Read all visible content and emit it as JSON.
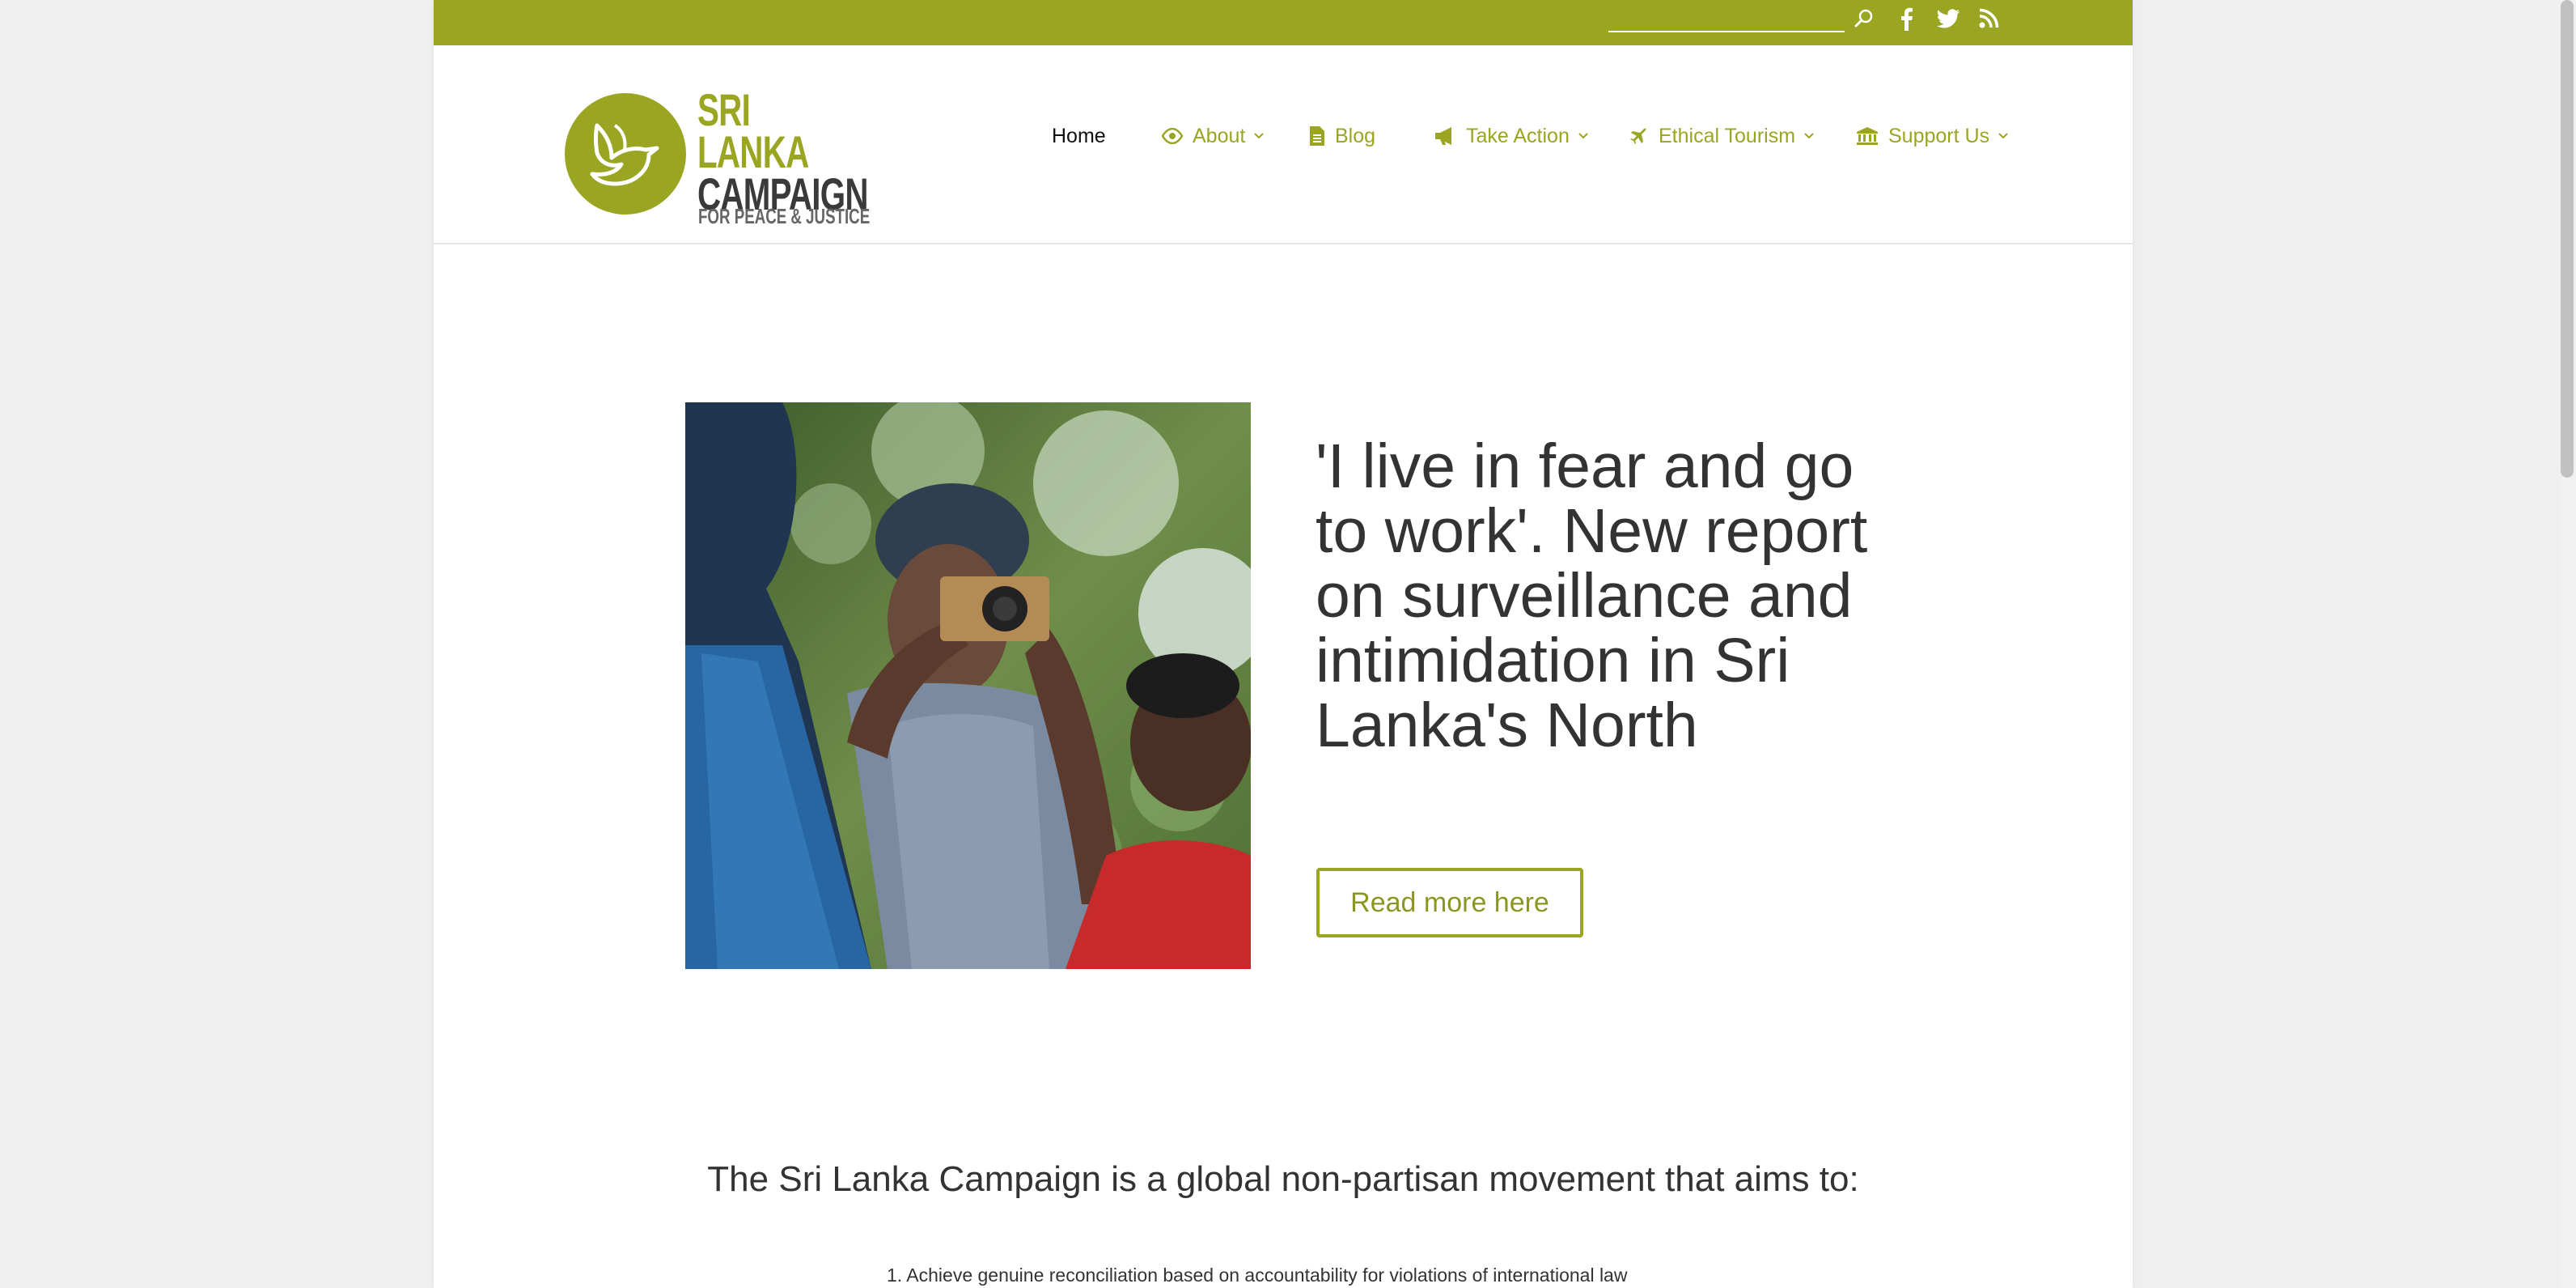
{
  "topbar": {
    "search_placeholder": "",
    "icons": [
      "search-icon",
      "facebook-icon",
      "twitter-icon",
      "rss-icon"
    ],
    "color": "#9aa522"
  },
  "logo": {
    "line1": "SRI",
    "line2": "LANKA",
    "line3": "CAMPAIGN",
    "tagline": "FOR PEACE & JUSTICE"
  },
  "nav": {
    "home": "Home",
    "about": "About",
    "blog": "Blog",
    "take_action": "Take Action",
    "ethical_tourism": "Ethical Tourism",
    "support_us": "Support Us"
  },
  "hero": {
    "title": "'I live in fear and go to work'. New report on surveillance and intimidation in Sri Lanka's North",
    "button": "Read more here"
  },
  "mission": {
    "heading": "The Sri Lanka Campaign is a global non-partisan movement that aims to:",
    "goals": [
      "1. Achieve genuine reconciliation based on accountability for violations of international law"
    ]
  },
  "colors": {
    "accent": "#9aa522",
    "text": "#333333",
    "page_bg": "#efefef"
  }
}
